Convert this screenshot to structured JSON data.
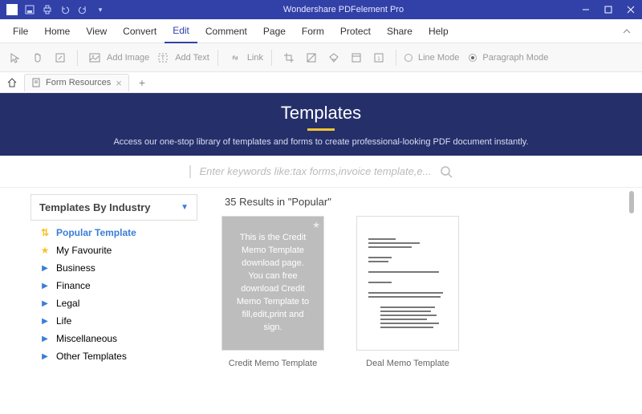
{
  "titlebar": {
    "title": "Wondershare PDFelement Pro"
  },
  "menu": {
    "items": [
      "File",
      "Home",
      "View",
      "Convert",
      "Edit",
      "Comment",
      "Page",
      "Form",
      "Protect",
      "Share",
      "Help"
    ],
    "activeIndex": 4
  },
  "ribbon": {
    "addImage": "Add Image",
    "addText": "Add Text",
    "link": "Link",
    "lineMode": "Line Mode",
    "paragraphMode": "Paragraph Mode"
  },
  "tabs": {
    "tab1": "Form Resources"
  },
  "hero": {
    "title": "Templates",
    "subtitle": "Access our one-stop library of templates and forms to create professional-looking PDF document instantly."
  },
  "search": {
    "placeholder": "Enter keywords like:tax forms,invoice template,e..."
  },
  "sidebar": {
    "header": "Templates By Industry",
    "categories": [
      {
        "label": "Popular Template",
        "icon": "updown",
        "active": true
      },
      {
        "label": "My Favourite",
        "icon": "star"
      },
      {
        "label": "Business",
        "icon": "arrow"
      },
      {
        "label": "Finance",
        "icon": "arrow"
      },
      {
        "label": "Legal",
        "icon": "arrow"
      },
      {
        "label": "Life",
        "icon": "arrow"
      },
      {
        "label": "Miscellaneous",
        "icon": "arrow"
      },
      {
        "label": "Other Templates",
        "icon": "arrow"
      }
    ]
  },
  "results": {
    "count": "35",
    "label": " Results in \"Popular\"",
    "items": [
      {
        "title": "Credit Memo Template",
        "preview": "This is the Credit Memo Template download page. You can free download Credit Memo Template to fill,edit,print and sign."
      },
      {
        "title": "Deal Memo Template"
      }
    ]
  }
}
